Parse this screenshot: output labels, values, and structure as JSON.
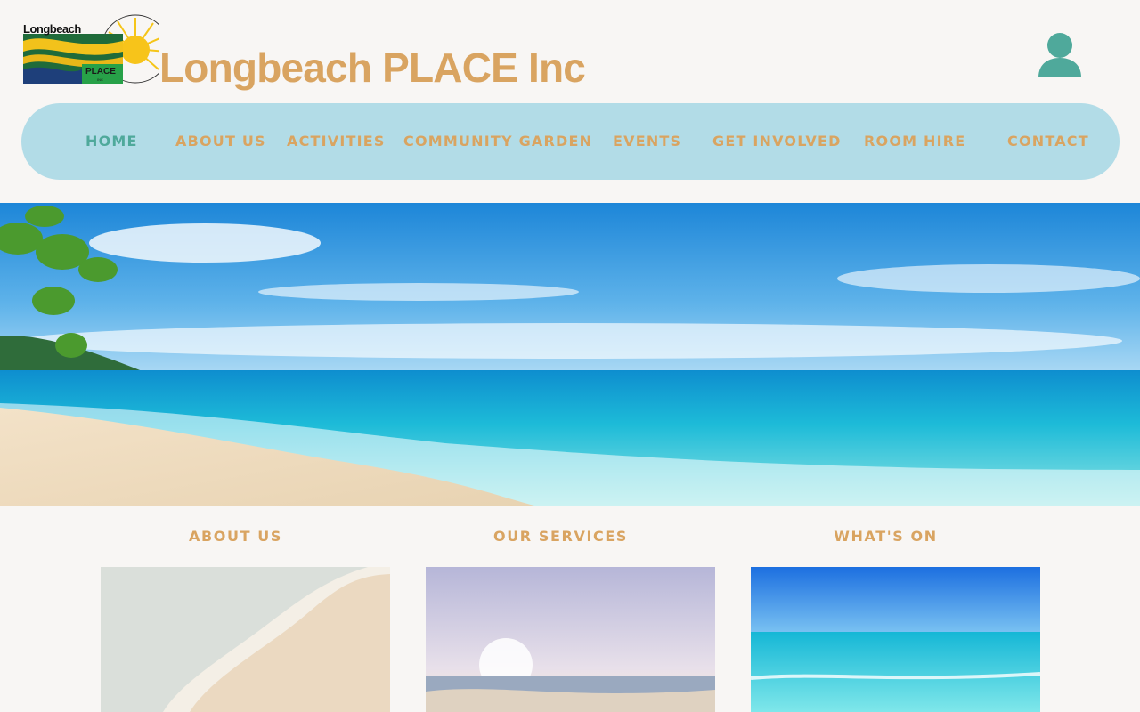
{
  "header": {
    "logo": {
      "line1": "Longbeach",
      "line2": "PLACE",
      "line3": "INC"
    },
    "site_title": "Longbeach PLACE Inc",
    "account_icon": "person-icon"
  },
  "nav": {
    "items": [
      {
        "label": "HOME",
        "active": true
      },
      {
        "label": "ABOUT US"
      },
      {
        "label": "ACTIVITIES"
      },
      {
        "label": "COMMUNITY GARDEN"
      },
      {
        "label": "EVENTS"
      },
      {
        "label": "GET INVOLVED"
      },
      {
        "label": "ROOM HIRE"
      },
      {
        "label": "CONTACT"
      }
    ]
  },
  "sections": [
    {
      "title": "ABOUT US"
    },
    {
      "title": "OUR SERVICES"
    },
    {
      "title": "WHAT'S ON"
    }
  ],
  "colors": {
    "background": "#f8f6f4",
    "accent": "#d9a461",
    "active": "#4fa99b",
    "nav_bg": "#b2dce7"
  }
}
